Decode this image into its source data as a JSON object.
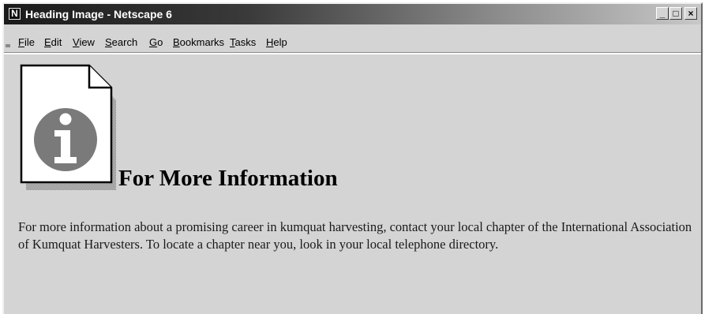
{
  "window": {
    "title": "Heading Image - Netscape 6",
    "app_icon_letter": "N",
    "controls": {
      "minimize": "_",
      "maximize": "□",
      "close": "×"
    }
  },
  "menubar": {
    "items": [
      {
        "label": "File",
        "accelerator": "F"
      },
      {
        "label": "Edit",
        "accelerator": "E"
      },
      {
        "label": "View",
        "accelerator": "V"
      },
      {
        "label": "Search",
        "accelerator": "S"
      },
      {
        "label": "Go",
        "accelerator": "G"
      },
      {
        "label": "Bookmarks",
        "accelerator": "B"
      },
      {
        "label": "Tasks",
        "accelerator": "T"
      },
      {
        "label": "Help",
        "accelerator": "H"
      }
    ]
  },
  "page": {
    "heading_icon": "info-document-icon",
    "heading": "For More Information",
    "paragraph": "For more information about a promising career in kumquat harvesting, contact your local chapter of the International Association of Kumquat Harvesters. To locate a chapter near you, look in your local telephone directory."
  },
  "colors": {
    "window_bg": "#d4d4d4",
    "titlebar_dark": "#1a1a1a",
    "titlebar_light": "#c8c8c8",
    "icon_gray": "#7a7a7a"
  }
}
